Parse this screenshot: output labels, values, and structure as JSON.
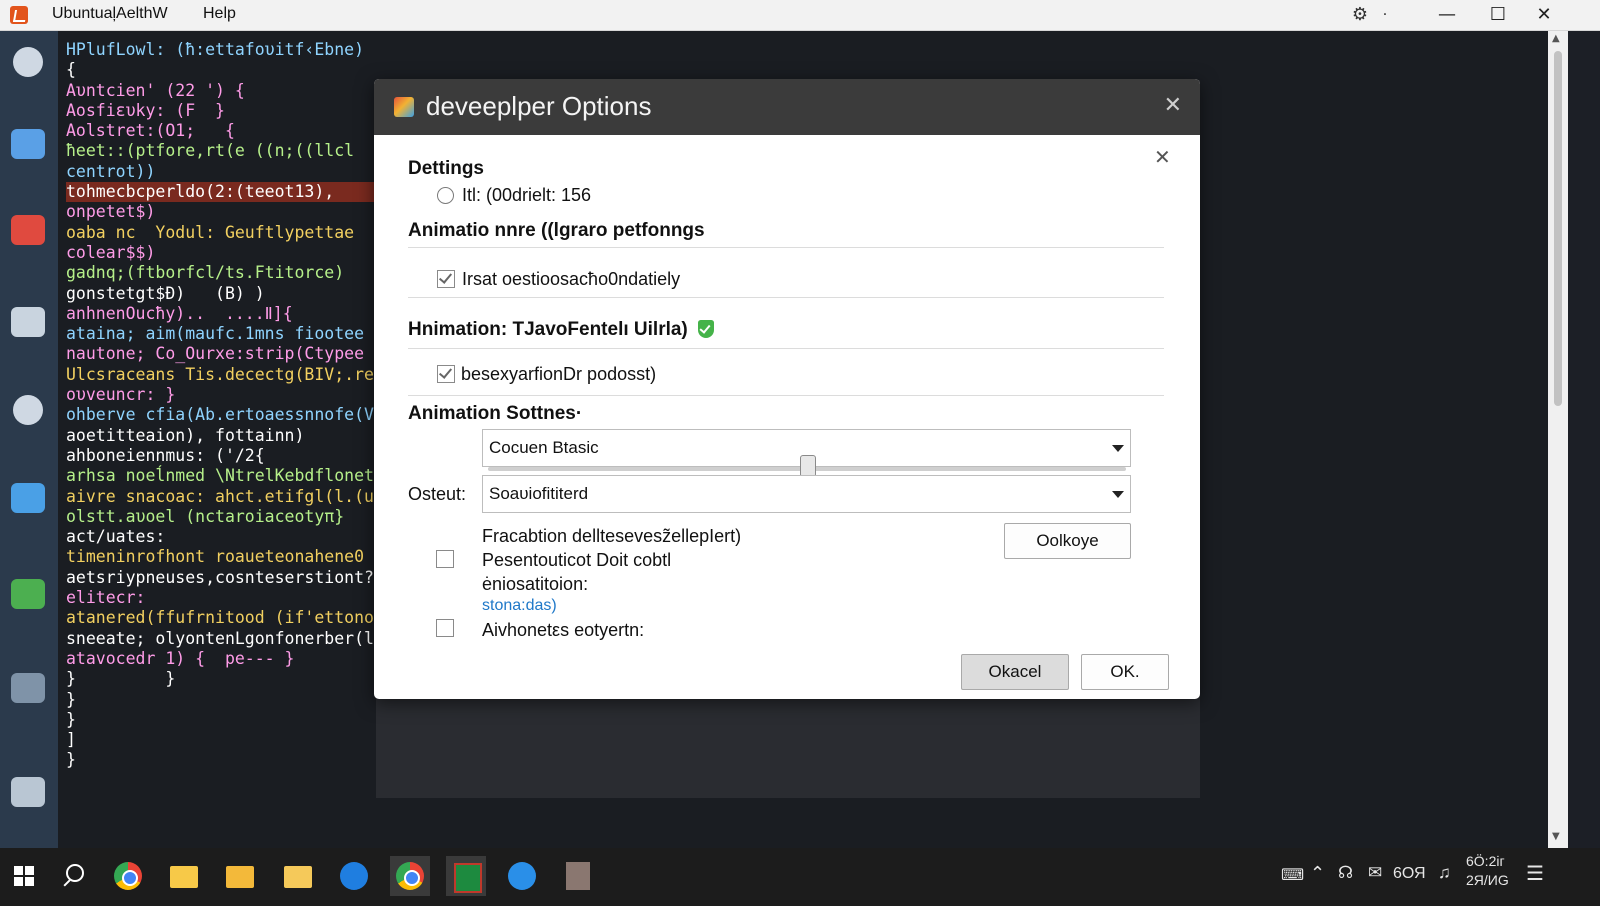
{
  "window": {
    "title": "UbuntuaļAelthW",
    "menu_help": "Help",
    "minimize": "—",
    "maximize": "☐",
    "close": "✕",
    "tray_left": "⚙",
    "tray_dot": "·"
  },
  "editor": {
    "lines": [
      {
        "text": "HPlufLowl: (ħ:ettafoυitf‹Ebne)",
        "color": "c2"
      },
      {
        "text": "{",
        "color": "c0"
      },
      {
        "text": "Aυntcien' (22 ') {",
        "color": "c3"
      },
      {
        "text": "Aosfiευky: (F  }",
        "color": "c3"
      },
      {
        "text": "Aolstret:(O1;   {",
        "color": "c3"
      },
      {
        "text": "ħeet::(ptfore,rt(e ((n;((llcl",
        "color": "c4"
      },
      {
        "text": "centrot))",
        "color": "c2"
      },
      {
        "text": "tohmecbcperldo(2:(teeot13),",
        "color": "c0",
        "highlight": true
      },
      {
        "text": "onpetet$)",
        "color": "c3"
      },
      {
        "text": "oaba nc  Yodul: Geuftlypettae",
        "color": "c1"
      },
      {
        "text": "colear$$)",
        "color": "c3"
      },
      {
        "text": "gadnq;(ftborfcl/ts.Ftitorce)",
        "color": "c4"
      },
      {
        "text": "gonstetgt$Ð)   (B) )",
        "color": "c0"
      },
      {
        "text": "anhnenOucħy)..  ....Ⅱ]{",
        "color": "c3"
      },
      {
        "text": "ataina; aim(maufc.1mns fiootee",
        "color": "c2"
      },
      {
        "text": "nautone; Co_Ourxe:strip(Ctypee",
        "color": "c3"
      },
      {
        "text": "Ulcsraceans Tis.decectg(BIV;.re",
        "color": "c1"
      },
      {
        "text": "oυveuncr: }",
        "color": "c3"
      },
      {
        "text": "ohberve cfia(Ab.ertoaessnnofe(VU",
        "color": "c2"
      },
      {
        "text": "aoetitteaion), fottainn)",
        "color": "c0"
      },
      {
        "text": "ahboneiennmus: ('/2{",
        "color": "c0"
      },
      {
        "text": "arhsa noeĺnmed \\NtrelKebdflonet",
        "color": "c4"
      },
      {
        "text": "aivre snacoac: ahct.etifgl(l.(u",
        "color": "c1"
      },
      {
        "text": "olstt.aυoel (nctaroiaceotyπ}",
        "color": "c4"
      },
      {
        "text": "act/uates:",
        "color": "c0"
      },
      {
        "text": "timeninrofhont roaueteonahene0",
        "color": "c1"
      },
      {
        "text": "aetsriypneuses,cosnteserstiont?",
        "color": "c0"
      },
      {
        "text": "elitecr:",
        "color": "c3"
      },
      {
        "text": "atanered(ffufrnitood (if'ettonot",
        "color": "c1"
      },
      {
        "text": "sneeate; olyontenLgonfonerber(l",
        "color": "c0"
      },
      {
        "text": "atavocedr 1) {  pe--- }",
        "color": "c3"
      },
      {
        "text": "}         }",
        "color": "c0"
      },
      {
        "text": "}",
        "color": "c0"
      },
      {
        "text": "}",
        "color": "c0"
      },
      {
        "text": "]",
        "color": "c0"
      },
      {
        "text": "}",
        "color": "c0"
      }
    ]
  },
  "dialog": {
    "title": "deveeplper Options",
    "close": "✕",
    "inner_close": "✕",
    "settings_heading": "Dettings",
    "radio_label": "Itl: (00drielt:  156",
    "anim_heading": "Animatio nnre ((lgraro  petfonngs",
    "check1_label": "Irsat oestioosacħo0ndatiely",
    "check1_checked": true,
    "hanim_heading": "Hnimation: TJavoFentelı Uilrla)",
    "check2_label": "besexyarfionDr podosst)",
    "check2_checked": true,
    "anim_sottings_heading": "Animation Sottnes·",
    "select1_value": "Cocuen Btasic",
    "slider_level": 0.5,
    "ostout_label": "Osteut:",
    "select2_value": "Soaυiofititerd",
    "frac_line1": "Fracabtion delltesevesz̃ellepIert)",
    "frac_line2": "Pesentouticot  Doit cobtl",
    "frac_line3": "ėniosatitoion:",
    "frac_link": "stona:das)",
    "frac_checked": false,
    "aivh_label": "Aivhonetεs eotyertn:",
    "aivh_checked": false,
    "side_button": "Oolkoye",
    "okcancel_button": "Okacel",
    "ok_button": "OK.",
    "colors": {
      "title_bg": "#3b3b3b",
      "shield": "#45b349",
      "link": "#1f78c8"
    }
  },
  "taskbar": {
    "items": [
      "windows-start-icon",
      "search-icon",
      "chrome-icon",
      "folder-icon",
      "folder-icon",
      "folder-icon",
      "edge-icon",
      "chrome-icon",
      "excel-icon",
      "edge-icon",
      "file-icon"
    ],
    "tray_lang": "6ОЯ",
    "clock_time": "6Ö:2іг",
    "clock_date": "2Я/ИG",
    "tray_icons": [
      "keyboard-icon",
      "chevron-up-icon",
      "network-icon",
      "mail-icon",
      "volume-icon",
      "notification-icon"
    ]
  }
}
